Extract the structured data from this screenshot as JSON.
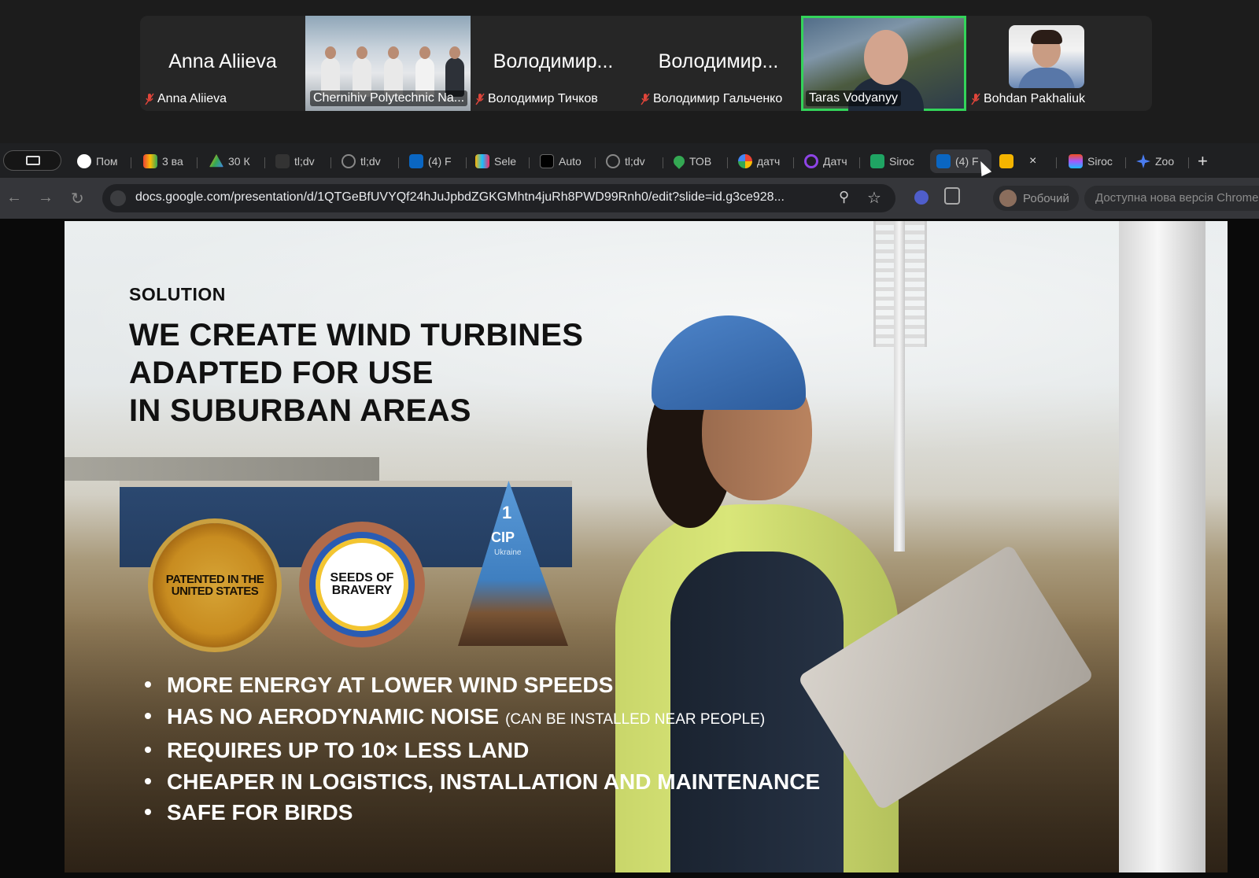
{
  "participants": [
    {
      "big_name": "Anna Aliieva",
      "label": "Anna Aliieva",
      "muted": true
    },
    {
      "big_name": "",
      "label": "Chernihiv Polytechnic Na...",
      "muted": false
    },
    {
      "big_name": "Володимир...",
      "label": "Володимир Тичков",
      "muted": true
    },
    {
      "big_name": "Володимир...",
      "label": "Володимир Гальченко",
      "muted": true
    },
    {
      "big_name": "",
      "label": "Taras Vodyanyy",
      "muted": false,
      "active_speaker": true
    },
    {
      "big_name": "",
      "label": "Bohdan Pakhaliuk",
      "muted": true
    }
  ],
  "tabs": [
    {
      "label": "Пом",
      "icon": "chatgpt-icon"
    },
    {
      "label": "3 ва",
      "icon": "gmail-icon"
    },
    {
      "label": "30 К",
      "icon": "google-drive-icon"
    },
    {
      "label": "tl;dv",
      "icon": "tldv-icon"
    },
    {
      "label": "tl;dv",
      "icon": "tldv-icon"
    },
    {
      "label": "(4) F",
      "icon": "linkedin-icon"
    },
    {
      "label": "Sele",
      "icon": "airtable-icon"
    },
    {
      "label": "Auto",
      "icon": "auto-icon"
    },
    {
      "label": "tl;dv",
      "icon": "tldv-icon"
    },
    {
      "label": "ТОВ",
      "icon": "maps-pin-icon"
    },
    {
      "label": "датч",
      "icon": "google-icon"
    },
    {
      "label": "Датч",
      "icon": "purple-app-icon"
    },
    {
      "label": "Siroc",
      "icon": "sheets-icon"
    },
    {
      "label": "(4) F",
      "icon": "linkedin-icon",
      "current": true
    },
    {
      "label": "",
      "icon": "slides-icon",
      "close": "×"
    },
    {
      "label": "Siroc",
      "icon": "figma-icon"
    },
    {
      "label": "Zoo",
      "icon": "gemini-icon"
    }
  ],
  "new_tab": "+",
  "address": {
    "url": "docs.google.com/presentation/d/1QTGeBfUVYQf24hJuJpbdZGKGMhtn4juRh8PWD99Rnh0/edit?slide=id.g3ce928...",
    "profile": "Робочий",
    "update_notice": "Доступна нова версія Chrome"
  },
  "slide": {
    "kicker": "SOLUTION",
    "headline": [
      "WE CREATE WIND TURBINES",
      "ADAPTED FOR USE",
      "IN SUBURBAN AREAS"
    ],
    "badge_patented": "PATENTED IN THE UNITED STATES",
    "badge_seeds": "SEEDS OF BRAVERY",
    "cip_number": "1",
    "cip_label": "CIP",
    "cip_sub": "Ukraine",
    "bullets": [
      {
        "text": "MORE ENERGY AT LOWER WIND SPEEDS",
        "note": ""
      },
      {
        "text": "HAS NO AERODYNAMIC NOISE",
        "note": "(CAN BE INSTALLED NEAR PEOPLE)"
      },
      {
        "text": "REQUIRES UP TO 10× LESS LAND",
        "note": ""
      },
      {
        "text": "CHEAPER IN LOGISTICS, INSTALLATION AND MAINTENANCE",
        "note": ""
      },
      {
        "text": "SAFE FOR BIRDS",
        "note": ""
      }
    ]
  },
  "colors": {
    "active_speaker": "#33d45a",
    "mic_off": "#e0453a",
    "helmet": "#3a70b5"
  }
}
